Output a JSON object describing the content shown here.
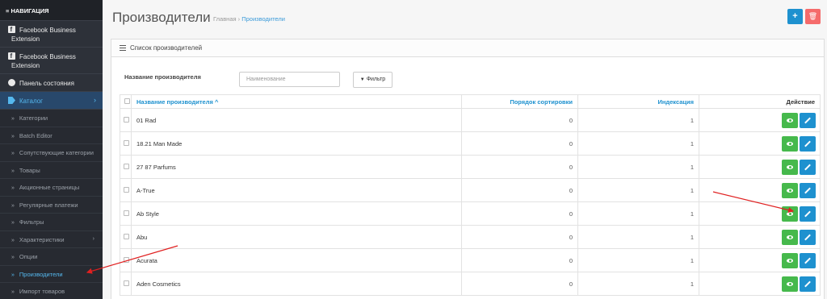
{
  "sidebar": {
    "header": "≡ НАВИГАЦИЯ",
    "fb1": {
      "line1": "Facebook Business",
      "line2": "Extension"
    },
    "fb2": {
      "line1": "Facebook Business",
      "line2": "Extension"
    },
    "dashboard": "Панель состояния",
    "catalog": "Каталог",
    "catalog_arrow": "›",
    "subitems": [
      {
        "label": "Категории"
      },
      {
        "label": "Batch Editor"
      },
      {
        "label": "Сопутствующие категории"
      },
      {
        "label": "Товары"
      },
      {
        "label": "Акционные страницы"
      },
      {
        "label": "Регулярные платежи"
      },
      {
        "label": "Фильтры"
      },
      {
        "label": "Характеристики"
      },
      {
        "label": "Опции"
      },
      {
        "label": "Производители"
      },
      {
        "label": "Импорт товаров"
      }
    ]
  },
  "header": {
    "title": "Производители",
    "breadcrumb_home": "Главная",
    "breadcrumb_sep": "›",
    "breadcrumb_current": "Производители",
    "add_icon": "+",
    "delete_icon": "🗑"
  },
  "panel": {
    "title": "Список производителей",
    "filter_label": "Название производителя",
    "filter_placeholder": "Наименование",
    "filter_button": "Фильтр",
    "filter_icon": "▼"
  },
  "table": {
    "headers": {
      "name": "Название производителя ^",
      "sort": "Порядок сортировки",
      "index": "Индексация",
      "action": "Действие"
    },
    "rows": [
      {
        "name": "01 Rad",
        "sort": "0",
        "index": "1"
      },
      {
        "name": "18.21 Man Made",
        "sort": "0",
        "index": "1"
      },
      {
        "name": "27 87 Parfums",
        "sort": "0",
        "index": "1"
      },
      {
        "name": "A-True",
        "sort": "0",
        "index": "1"
      },
      {
        "name": "Ab Style",
        "sort": "0",
        "index": "1"
      },
      {
        "name": "Abu",
        "sort": "0",
        "index": "1"
      },
      {
        "name": "Acurata",
        "sort": "0",
        "index": "1"
      },
      {
        "name": "Aden Cosmetics",
        "sort": "0",
        "index": "1"
      }
    ]
  },
  "colors": {
    "sidebar_bg": "#2d3139",
    "accent_blue": "#1e91cf",
    "green": "#46b94c",
    "red": "#f56b6b",
    "annotation": "#e02020"
  }
}
